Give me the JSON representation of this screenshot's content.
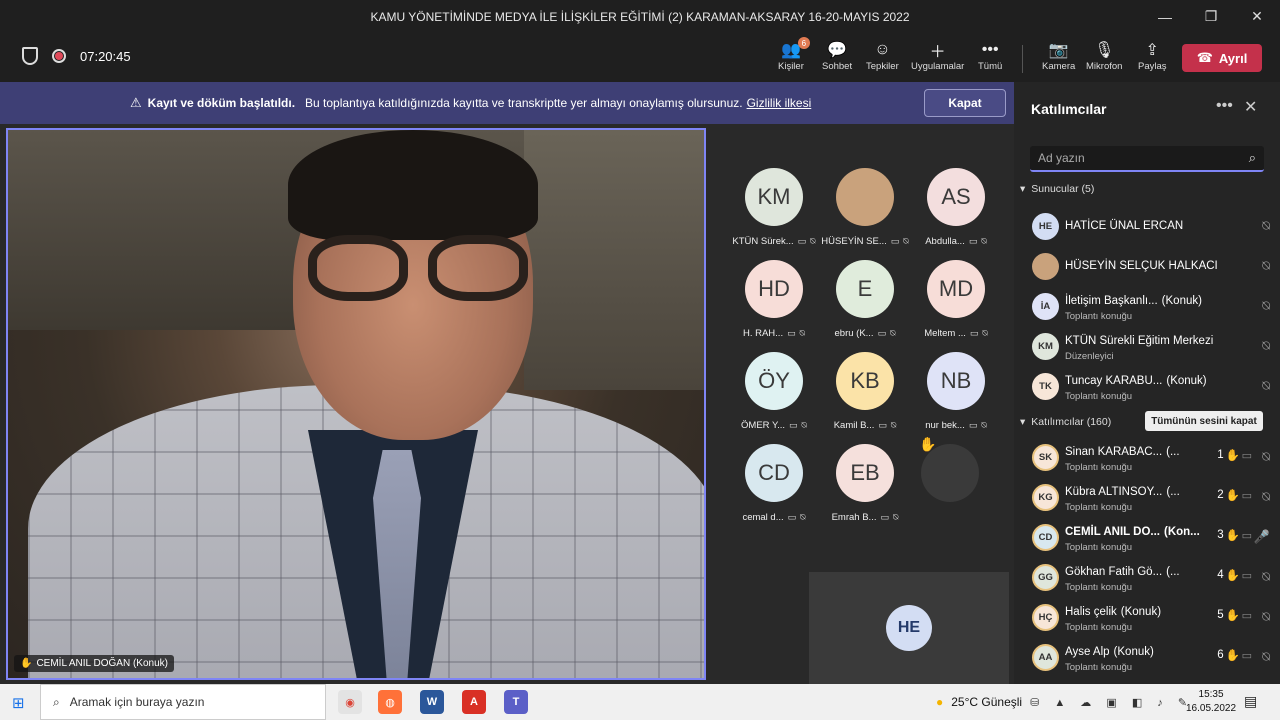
{
  "window": {
    "title": "KAMU YÖNETİMİNDE MEDYA İLE İLİŞKİLER EĞİTİMİ (2) KARAMAN-AKSARAY 16-20-MAYIS 2022"
  },
  "toolbar": {
    "timer": "07:20:45",
    "people_label": "Kişiler",
    "people_badge": "6",
    "chat_label": "Sohbet",
    "reactions_label": "Tepkiler",
    "apps_label": "Uygulamalar",
    "more_label": "Tümü",
    "camera_label": "Kamera",
    "mic_label": "Mikrofon",
    "share_label": "Paylaş",
    "leave_label": "Ayrıl"
  },
  "banner": {
    "bold": "Kayıt ve döküm başlatıldı.",
    "text": "Bu toplantıya katıldığınızda kayıtta ve transkriptte yer almayı onaylamış olursunuz.",
    "link": "Gizlilik ilkesi",
    "close": "Kapat"
  },
  "main_video": {
    "name": "CEMİL ANIL DOĞAN (Konuk)"
  },
  "tiles": [
    {
      "initials": "KM",
      "label": "KTÜN Sürek...",
      "color": "#dfe6dc"
    },
    {
      "initials": "",
      "label": "HÜSEYİN SE...",
      "color": "#c9a27c"
    },
    {
      "initials": "AS",
      "label": "Abdulla...",
      "color": "#f3dede"
    },
    {
      "initials": "HD",
      "label": "H. RAH...",
      "color": "#f7ddd8"
    },
    {
      "initials": "E",
      "label": "ebru (K...",
      "color": "#e0ecdc"
    },
    {
      "initials": "MD",
      "label": "Meltem ...",
      "color": "#f7ddd8"
    },
    {
      "initials": "ÖY",
      "label": "ÖMER Y...",
      "color": "#dff2f2"
    },
    {
      "initials": "KB",
      "label": "Kamil B...",
      "color": "#fbe3a8"
    },
    {
      "initials": "NB",
      "label": "nur bek...",
      "color": "#dfe3f7"
    },
    {
      "initials": "CD",
      "label": "cemal d...",
      "color": "#d8e8ef"
    },
    {
      "initials": "EB",
      "label": "Emrah B...",
      "color": "#f5e0dc"
    }
  ],
  "he_box": {
    "initials": "HE"
  },
  "panel": {
    "title": "Katılımcılar",
    "search_placeholder": "Ad yazın",
    "presenters_label": "Sunucular (5)",
    "attendees_label": "Katılımcılar (160)",
    "mute_all": "Tümünün sesini kapat",
    "presenters": [
      {
        "initials": "HE",
        "name": "HATİCE ÜNAL ERCAN",
        "tag": "",
        "sub": "",
        "color": "#d3ddf3"
      },
      {
        "initials": "",
        "name": "HÜSEYİN SELÇUK HALKACI",
        "tag": "",
        "sub": "",
        "color": "#c9a27c"
      },
      {
        "initials": "İA",
        "name": "İletişim Başkanlı...",
        "tag": "(Konuk)",
        "sub": "Toplantı konuğu",
        "color": "#dfe3f7"
      },
      {
        "initials": "KM",
        "name": "KTÜN Sürekli Eğitim Merkezi",
        "tag": "",
        "sub": "Düzenleyici",
        "color": "#dfe6dc"
      },
      {
        "initials": "TK",
        "name": "Tuncay KARABU...",
        "tag": "(Konuk)",
        "sub": "Toplantı konuğu",
        "color": "#f7e6d8"
      }
    ],
    "attendees": [
      {
        "initials": "SK",
        "name": "Sinan KARABAC...",
        "tag": "(...",
        "sub": "Toplantı konuğu",
        "hand": "1",
        "color": "#f7e6d8"
      },
      {
        "initials": "KG",
        "name": "Kübra ALTINSOY...",
        "tag": "(...",
        "sub": "Toplantı konuğu",
        "hand": "2",
        "color": "#f7e6d8"
      },
      {
        "initials": "CD",
        "name": "CEMİL ANIL DO...",
        "tag": "(Kon...",
        "sub": "Toplantı konuğu",
        "hand": "3",
        "color": "#d8e8ef"
      },
      {
        "initials": "GG",
        "name": "Gökhan Fatih Gö...",
        "tag": "(...",
        "sub": "Toplantı konuğu",
        "hand": "4",
        "color": "#dfe6dc"
      },
      {
        "initials": "HÇ",
        "name": "Halis çelik",
        "tag": "(Konuk)",
        "sub": "Toplantı konuğu",
        "hand": "5",
        "color": "#f7e6d8"
      },
      {
        "initials": "AA",
        "name": "Ayse Alp",
        "tag": "(Konuk)",
        "sub": "Toplantı konuğu",
        "hand": "6",
        "color": "#dfe6dc"
      }
    ]
  },
  "taskbar": {
    "search_placeholder": "Aramak için buraya yazın",
    "weather": "25°C  Güneşli",
    "time": "15:35",
    "date": "16.05.2022"
  }
}
